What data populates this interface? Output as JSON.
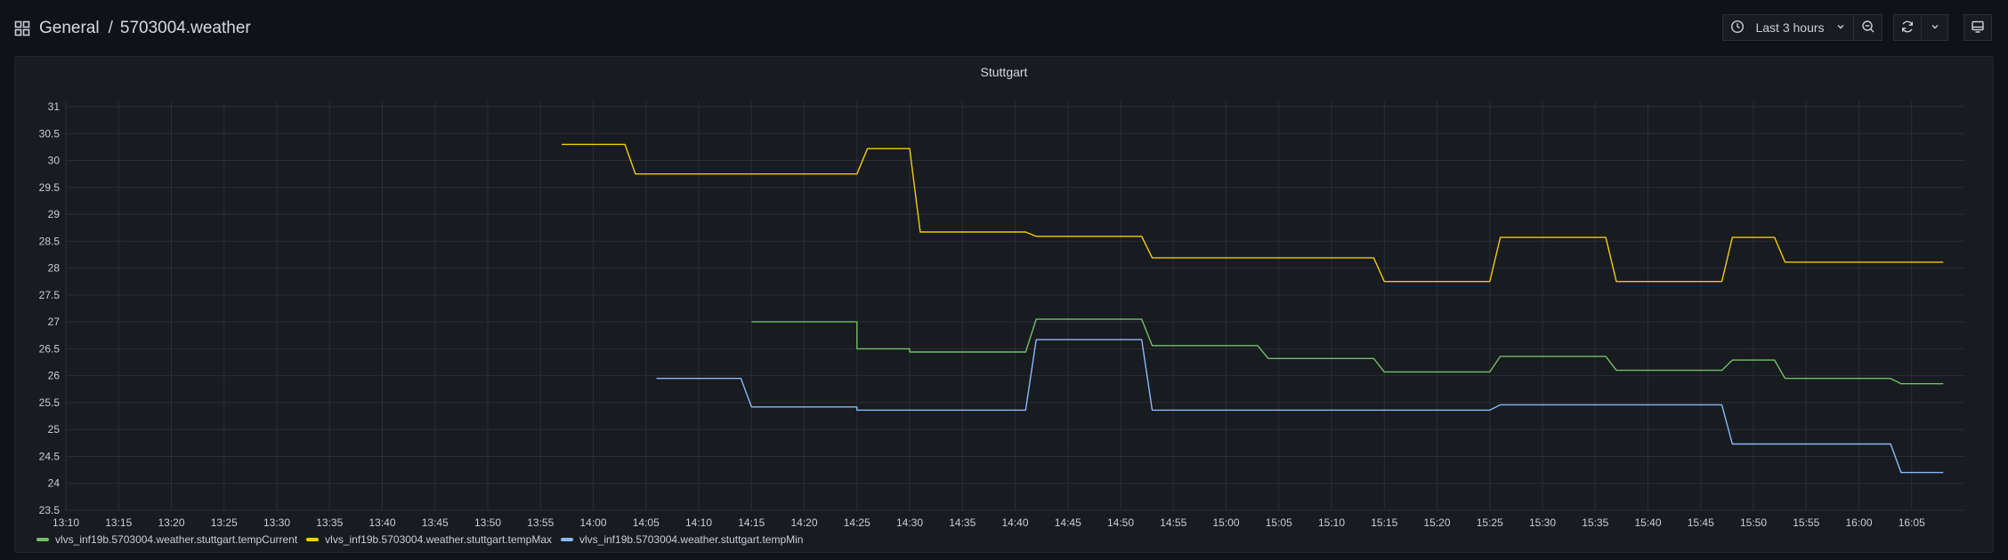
{
  "breadcrumb": {
    "folder": "General",
    "separator": "/",
    "dashboard": "5703004.weather"
  },
  "toolbar": {
    "time_range_label": "Last 3 hours"
  },
  "icons": {
    "dashboards": "grid-icon",
    "clock": "clock-icon",
    "time_dropdown": "chevron-down-icon",
    "zoom_out": "zoom-out-icon",
    "refresh": "refresh-icon",
    "refresh_interval": "chevron-down-icon",
    "view_mode": "monitor-icon"
  },
  "colors": {
    "tempCurrent": "#73bf69",
    "tempMax": "#f2cc0c",
    "tempMin": "#8ab8ff"
  },
  "chart_data": {
    "type": "line",
    "title": "Stuttgart",
    "xlabel": "",
    "ylabel": "",
    "x_ticks": [
      "13:10",
      "13:15",
      "13:20",
      "13:25",
      "13:30",
      "13:35",
      "13:40",
      "13:45",
      "13:50",
      "13:55",
      "14:00",
      "14:05",
      "14:10",
      "14:15",
      "14:20",
      "14:25",
      "14:30",
      "14:35",
      "14:40",
      "14:45",
      "14:50",
      "14:55",
      "15:00",
      "15:05",
      "15:10",
      "15:15",
      "15:20",
      "15:25",
      "15:30",
      "15:35",
      "15:40",
      "15:45",
      "15:50",
      "15:55",
      "16:00",
      "16:05"
    ],
    "x_range": [
      "13:10",
      "16:10"
    ],
    "y_ticks": [
      "31",
      "30.5",
      "30",
      "29.5",
      "29",
      "28.5",
      "28",
      "27.5",
      "27",
      "26.5",
      "26",
      "25.5",
      "25",
      "24.5",
      "24",
      "23.5"
    ],
    "ylim": [
      23.5,
      31
    ],
    "grid": true,
    "legend_position": "bottom-left",
    "series": [
      {
        "name": "vlvs_inf19b.5703004.weather.stuttgart.tempCurrent",
        "color": "#73bf69",
        "points": [
          [
            "14:15",
            27.0
          ],
          [
            "14:25",
            27.0
          ],
          [
            "14:25",
            26.5
          ],
          [
            "14:30",
            26.5
          ],
          [
            "14:30",
            26.44
          ],
          [
            "14:41",
            26.44
          ],
          [
            "14:42",
            27.05
          ],
          [
            "14:52",
            27.05
          ],
          [
            "14:53",
            26.56
          ],
          [
            "15:03",
            26.56
          ],
          [
            "15:04",
            26.32
          ],
          [
            "15:14",
            26.32
          ],
          [
            "15:15",
            26.07
          ],
          [
            "15:25",
            26.07
          ],
          [
            "15:26",
            26.36
          ],
          [
            "15:36",
            26.36
          ],
          [
            "15:37",
            26.1
          ],
          [
            "15:47",
            26.1
          ],
          [
            "15:48",
            26.29
          ],
          [
            "15:52",
            26.29
          ],
          [
            "15:53",
            25.95
          ],
          [
            "16:03",
            25.95
          ],
          [
            "16:04",
            25.85
          ],
          [
            "16:08",
            25.85
          ]
        ]
      },
      {
        "name": "vlvs_inf19b.5703004.weather.stuttgart.tempMax",
        "color": "#f2cc0c",
        "points": [
          [
            "13:57",
            30.3
          ],
          [
            "14:03",
            30.3
          ],
          [
            "14:04",
            29.75
          ],
          [
            "14:25",
            29.75
          ],
          [
            "14:26",
            30.22
          ],
          [
            "14:30",
            30.22
          ],
          [
            "14:31",
            28.67
          ],
          [
            "14:41",
            28.67
          ],
          [
            "14:42",
            28.59
          ],
          [
            "14:52",
            28.59
          ],
          [
            "14:53",
            28.19
          ],
          [
            "15:14",
            28.19
          ],
          [
            "15:15",
            27.75
          ],
          [
            "15:25",
            27.75
          ],
          [
            "15:26",
            28.57
          ],
          [
            "15:36",
            28.57
          ],
          [
            "15:37",
            27.75
          ],
          [
            "15:47",
            27.75
          ],
          [
            "15:48",
            28.57
          ],
          [
            "15:52",
            28.57
          ],
          [
            "15:53",
            28.11
          ],
          [
            "16:08",
            28.11
          ]
        ]
      },
      {
        "name": "vlvs_inf19b.5703004.weather.stuttgart.tempMin",
        "color": "#8ab8ff",
        "points": [
          [
            "14:06",
            25.95
          ],
          [
            "14:14",
            25.95
          ],
          [
            "14:15",
            25.42
          ],
          [
            "14:25",
            25.42
          ],
          [
            "14:25",
            25.36
          ],
          [
            "14:41",
            25.36
          ],
          [
            "14:42",
            26.67
          ],
          [
            "14:52",
            26.67
          ],
          [
            "14:53",
            25.36
          ],
          [
            "15:25",
            25.36
          ],
          [
            "15:26",
            25.46
          ],
          [
            "15:47",
            25.46
          ],
          [
            "15:48",
            24.73
          ],
          [
            "16:03",
            24.73
          ],
          [
            "16:04",
            24.2
          ],
          [
            "16:08",
            24.2
          ]
        ]
      }
    ]
  }
}
